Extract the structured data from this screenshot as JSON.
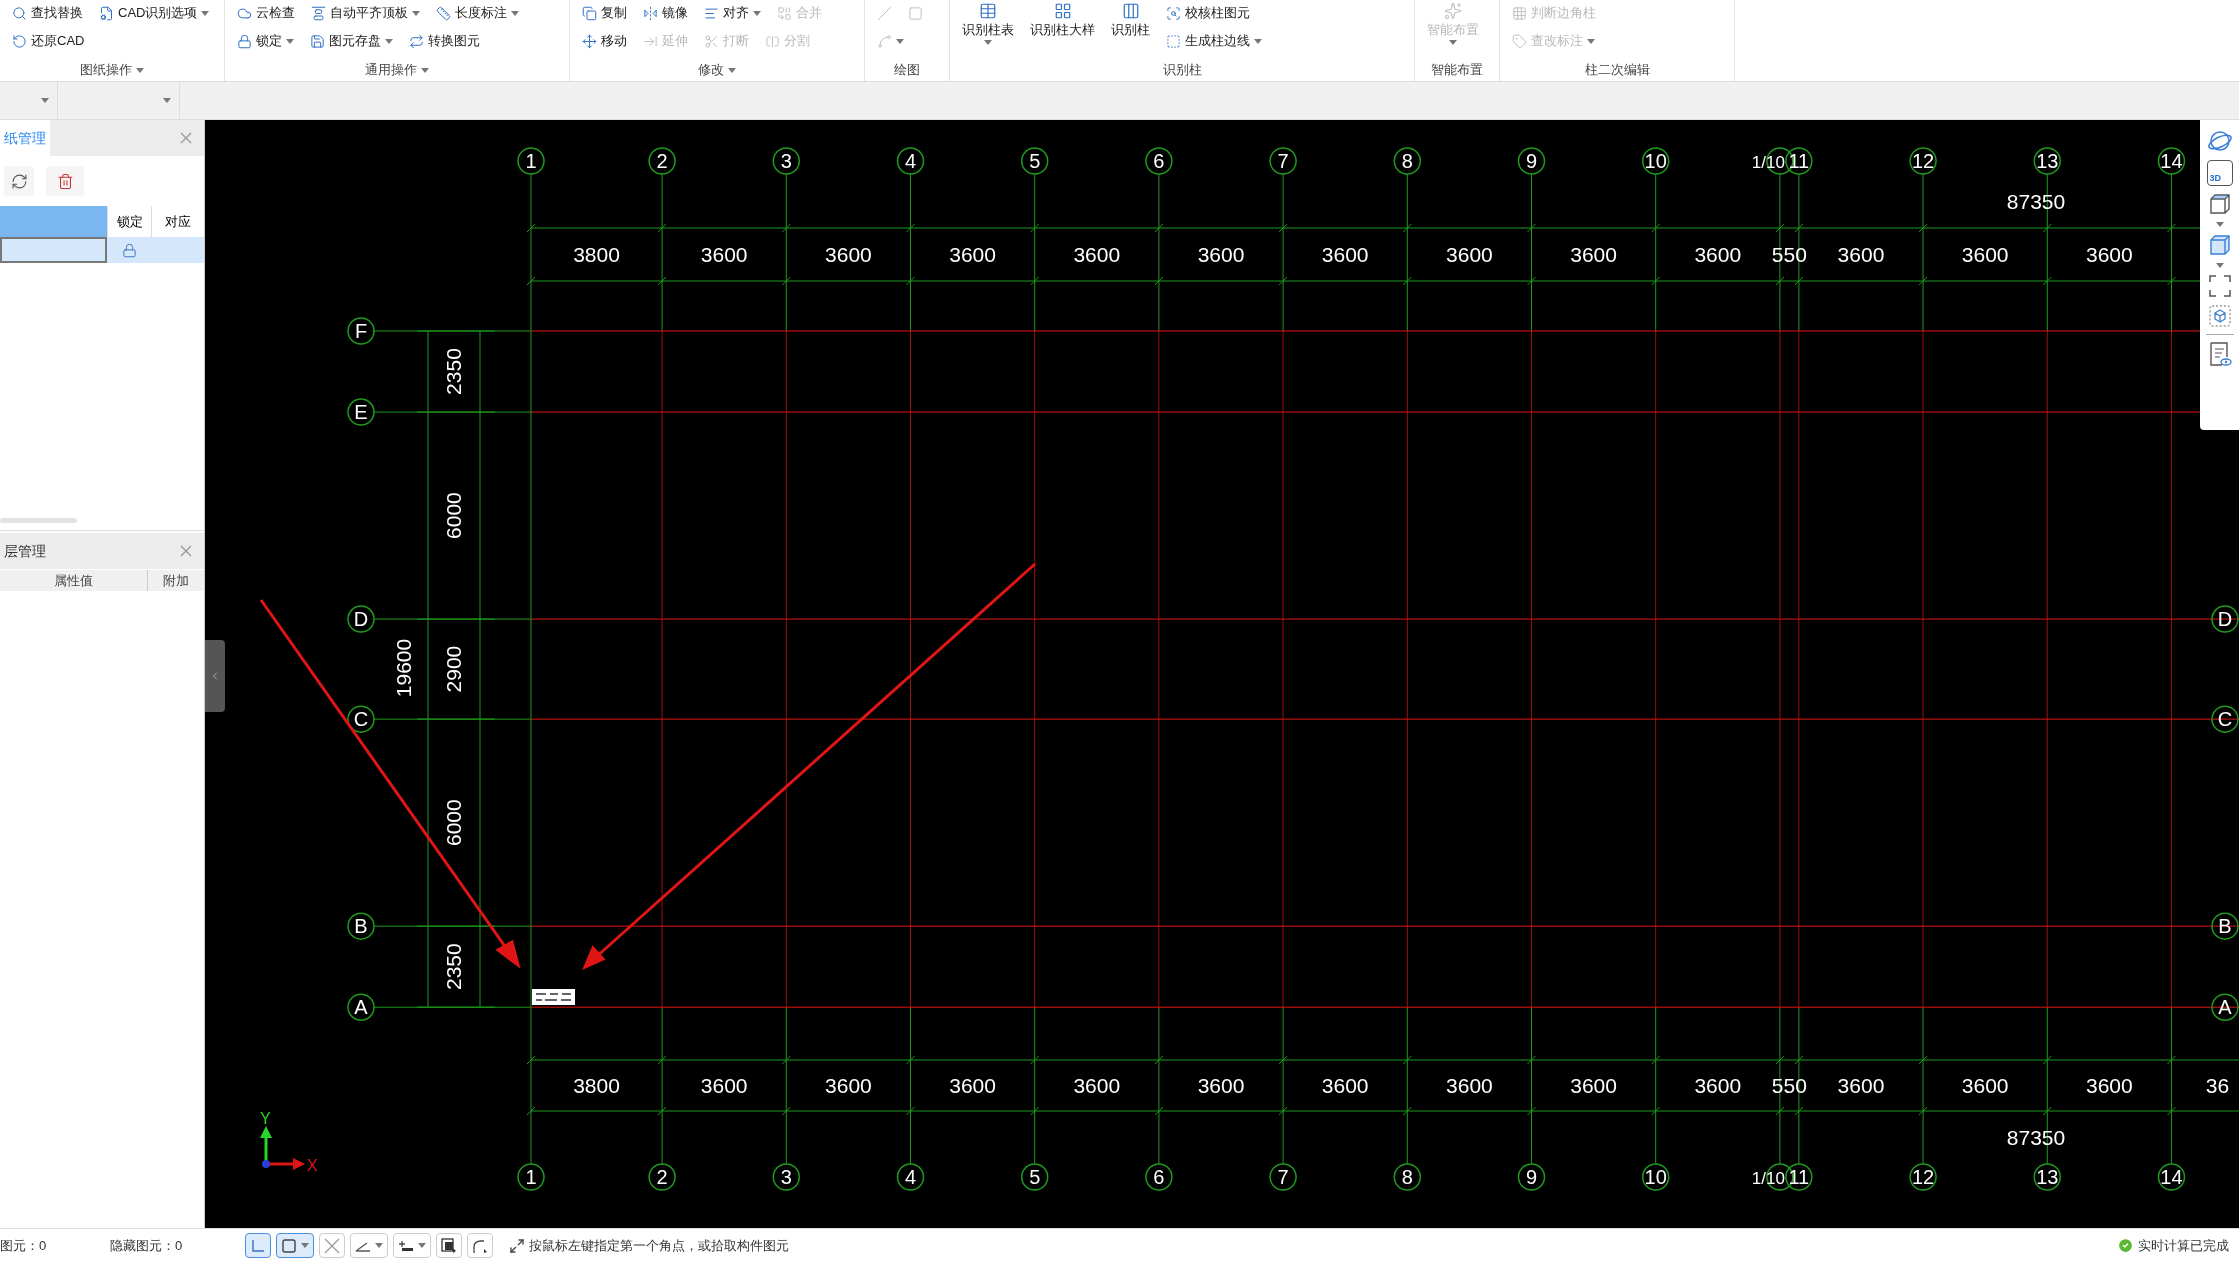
{
  "ribbon": [
    {
      "label": "图纸操作",
      "label_dropdown": true,
      "rows": [
        [
          {
            "label": "查找替换",
            "dropdown": false,
            "disabled": false
          },
          {
            "label": "CAD识别选项",
            "dropdown": true,
            "disabled": false
          }
        ],
        [
          {
            "label": "还原CAD",
            "dropdown": false,
            "disabled": false
          }
        ]
      ]
    },
    {
      "label": "通用操作",
      "label_dropdown": true,
      "rows": [
        [
          {
            "label": "云检查",
            "dropdown": false,
            "disabled": false
          },
          {
            "label": "自动平齐顶板",
            "dropdown": true,
            "disabled": false
          },
          {
            "label": "长度标注",
            "dropdown": true,
            "disabled": false
          }
        ],
        [
          {
            "label": "锁定",
            "dropdown": true,
            "disabled": false
          },
          {
            "label": "图元存盘",
            "dropdown": true,
            "disabled": false
          },
          {
            "label": "转换图元",
            "dropdown": false,
            "disabled": false
          }
        ]
      ]
    },
    {
      "label": "修改",
      "label_dropdown": true,
      "rows": [
        [
          {
            "label": "复制",
            "dropdown": false,
            "disabled": false
          },
          {
            "label": "镜像",
            "dropdown": false,
            "disabled": false
          },
          {
            "label": "对齐",
            "dropdown": true,
            "disabled": false
          },
          {
            "label": "合并",
            "dropdown": false,
            "disabled": true
          }
        ],
        [
          {
            "label": "移动",
            "dropdown": false,
            "disabled": false
          },
          {
            "label": "延伸",
            "dropdown": false,
            "disabled": true
          },
          {
            "label": "打断",
            "dropdown": false,
            "disabled": true
          },
          {
            "label": "分割",
            "dropdown": false,
            "disabled": true
          }
        ]
      ]
    },
    {
      "label": "绘图",
      "label_dropdown": false,
      "rows": [
        [
          {
            "dropdown": false,
            "disabled": true
          },
          {
            "dropdown": false,
            "disabled": true
          }
        ],
        [
          {
            "dropdown": true,
            "disabled": true
          }
        ]
      ]
    },
    {
      "label": "识别柱",
      "label_dropdown": false,
      "big": [
        {
          "label": "识别柱表",
          "dropdown": true,
          "disabled": false
        },
        {
          "label": "识别柱大样",
          "dropdown": false,
          "disabled": false
        },
        {
          "label": "识别柱",
          "dropdown": false,
          "disabled": false
        }
      ],
      "rows": [
        [
          {
            "label": "校核柱图元",
            "dropdown": false,
            "disabled": false
          }
        ],
        [
          {
            "label": "生成柱边线",
            "dropdown": true,
            "disabled": false
          }
        ]
      ]
    },
    {
      "label": "智能布置",
      "label_dropdown": false,
      "big": [
        {
          "label": "智能布置",
          "dropdown": true,
          "disabled": true
        }
      ]
    },
    {
      "label": "柱二次编辑",
      "label_dropdown": false,
      "rows": [
        [
          {
            "label": "判断边角柱",
            "dropdown": false,
            "disabled": true
          }
        ],
        [
          {
            "label": "查改标注",
            "dropdown": true,
            "disabled": true
          }
        ]
      ]
    }
  ],
  "drawing_panel": {
    "title": "纸管理",
    "columns": [
      "锁定",
      "对应"
    ],
    "rows": [
      {
        "selected": true,
        "locked": true
      }
    ]
  },
  "layer_panel": {
    "title": "层管理",
    "columns": [
      "属性值",
      "附加"
    ]
  },
  "canvas": {
    "top_labels": [
      "1",
      "2",
      "3",
      "4",
      "5",
      "6",
      "7",
      "8",
      "9",
      "10",
      "1/10",
      "11",
      "12",
      "13",
      "14"
    ],
    "bottom_labels": [
      "1",
      "2",
      "3",
      "4",
      "5",
      "6",
      "7",
      "8",
      "9",
      "10",
      "1/10",
      "11",
      "12",
      "13",
      "14"
    ],
    "rows": [
      {
        "label": "F",
        "right_bubble": false
      },
      {
        "label": "E",
        "right_bubble": false
      },
      {
        "label": "D",
        "right_bubble": true
      },
      {
        "label": "C",
        "right_bubble": true
      },
      {
        "label": "B",
        "right_bubble": true
      },
      {
        "label": "A",
        "right_bubble": true
      }
    ],
    "right_labels": [
      "D",
      "C",
      "B",
      "A"
    ],
    "top_dimensions": [
      "3800",
      "3600",
      "3600",
      "3600",
      "3600",
      "3600",
      "3600",
      "3600",
      "3600",
      "3600",
      "550",
      "3600",
      "3600",
      "3600"
    ],
    "bottom_dimensions": [
      "3800",
      "3600",
      "3600",
      "3600",
      "3600",
      "3600",
      "3600",
      "3600",
      "3600",
      "3600",
      "550",
      "3600",
      "3600",
      "3600",
      "36"
    ],
    "left_dimensions": [
      "2350",
      "6000",
      "2900",
      "6000",
      "2350"
    ],
    "top_total": "87350",
    "bottom_total": "87350",
    "left_total": "19600",
    "axis_indicator": {
      "x": "X",
      "y": "Y"
    }
  },
  "right_toolbar": {
    "badge": "3D"
  },
  "status_bar": {
    "selected_count": "图元：0",
    "hidden_count": "隐藏图元：0",
    "tools": [
      {
        "selected": true,
        "dropdown": false
      },
      {
        "selected": true,
        "dropdown": true
      },
      {
        "selected": false,
        "dropdown": false
      },
      {
        "selected": false,
        "dropdown": true
      },
      {
        "selected": false,
        "dropdown": true
      },
      {
        "selected": false,
        "dropdown": false
      },
      {
        "selected": false,
        "dropdown": false
      }
    ],
    "hint": "按鼠标左键指定第一个角点，或拾取构件图元",
    "status": "实时计算已完成"
  }
}
